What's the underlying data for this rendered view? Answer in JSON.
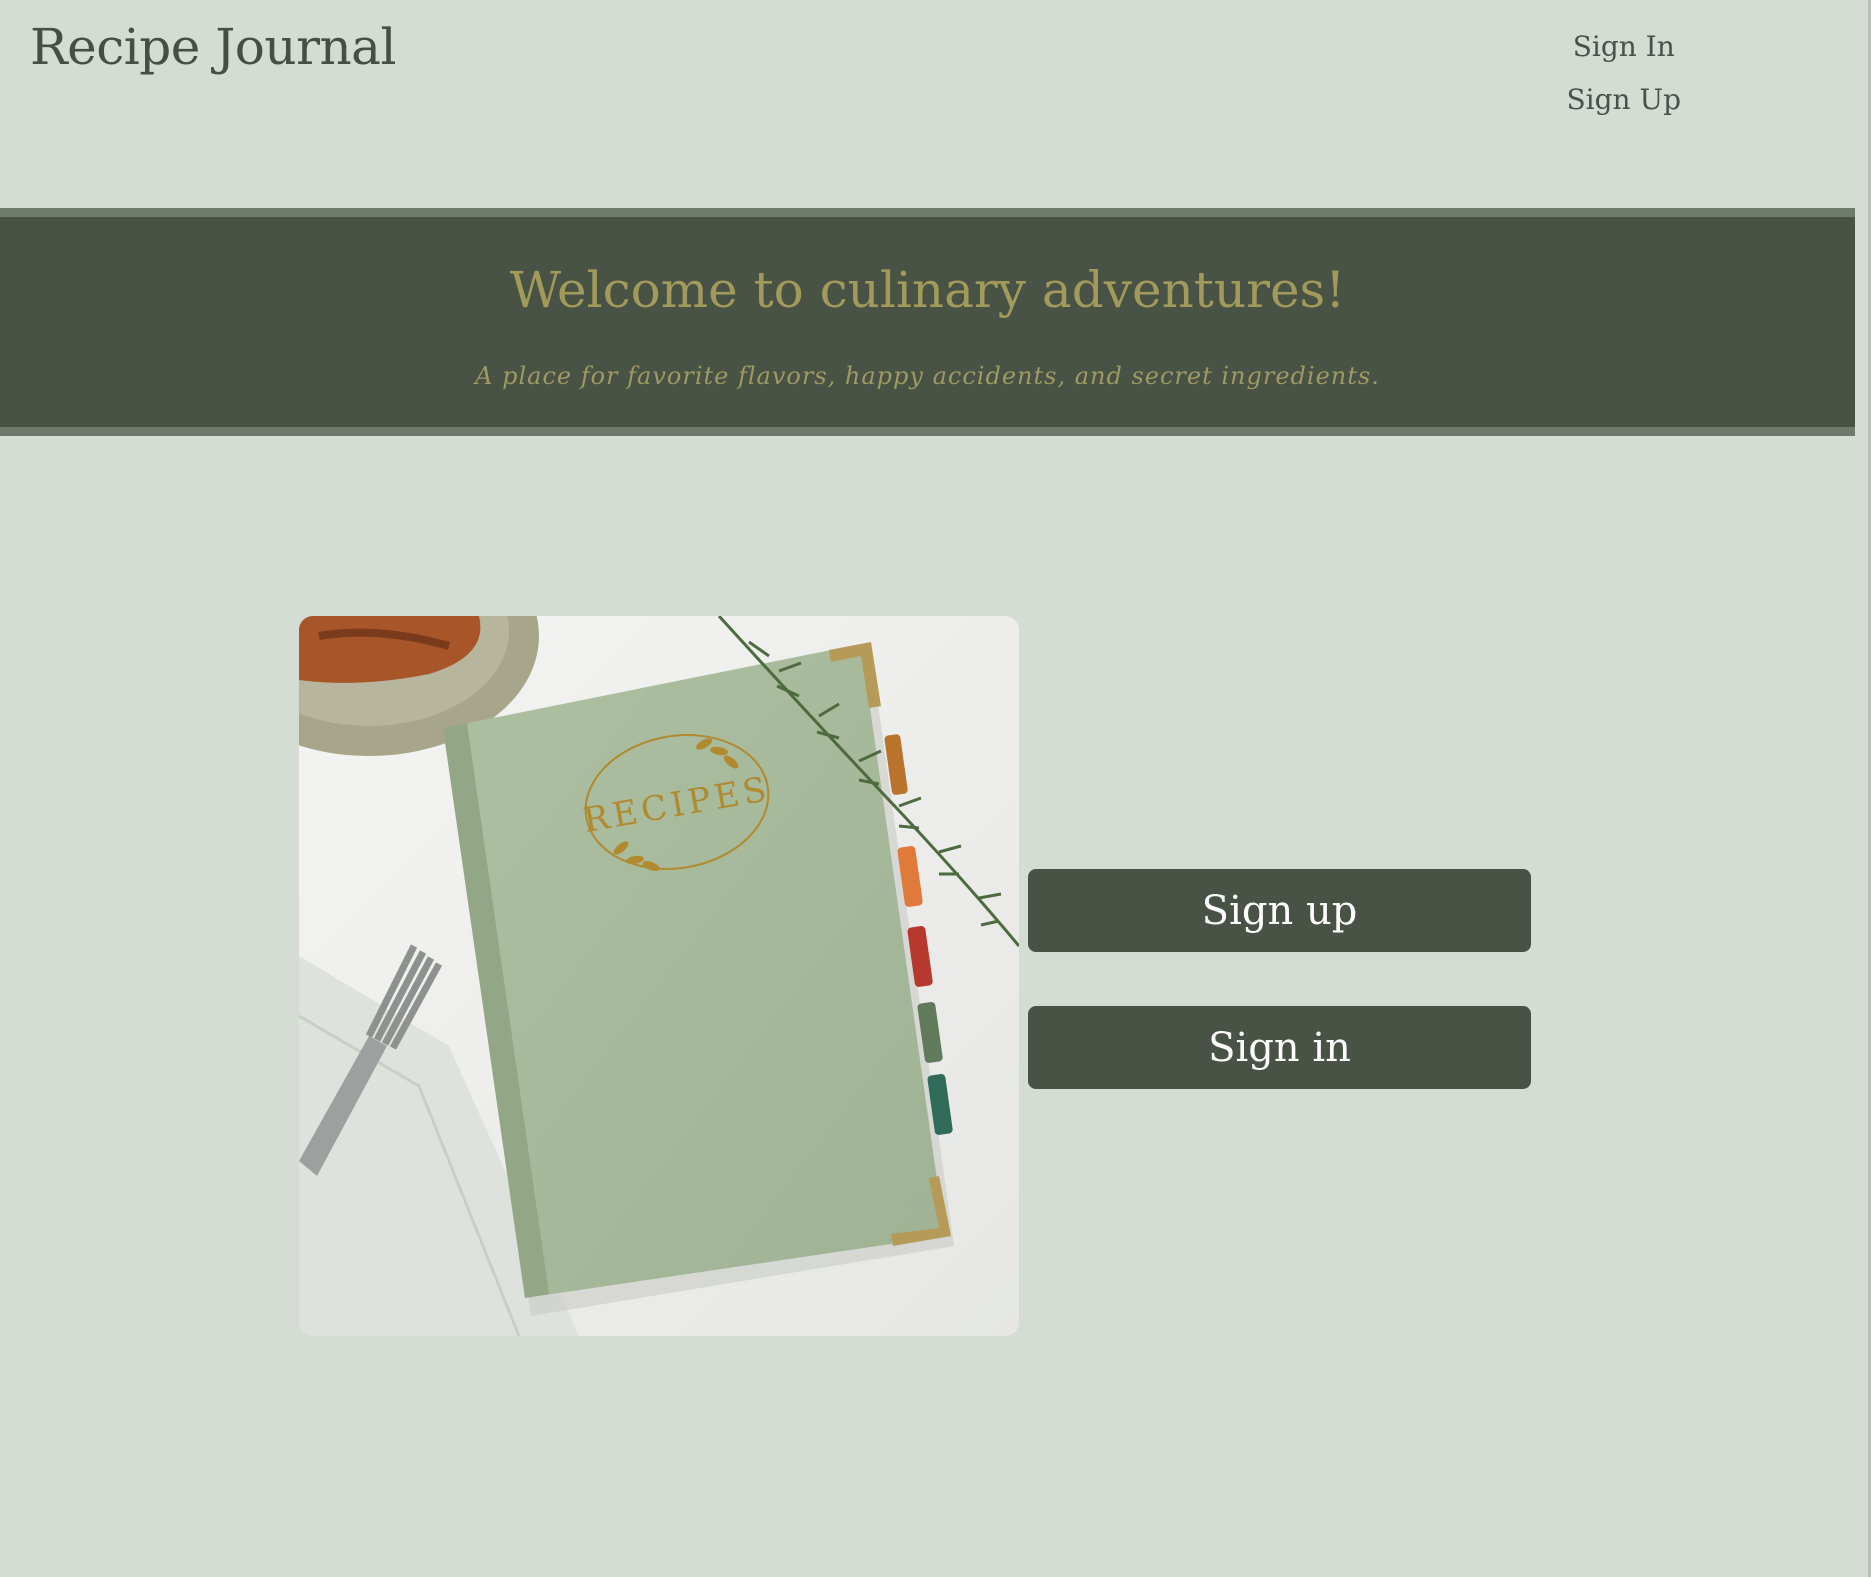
{
  "header": {
    "brand": "Recipe Journal",
    "nav": {
      "sign_in": "Sign In",
      "sign_up": "Sign Up"
    }
  },
  "banner": {
    "title": "Welcome to culinary adventures!",
    "tagline": "A place for favorite flavors, happy accidents, and secret ingredients."
  },
  "hero": {
    "book_label": "RECIPES"
  },
  "actions": {
    "sign_up": "Sign up",
    "sign_in": "Sign in"
  },
  "colors": {
    "page_bg": "#d4dcd3",
    "banner_bg": "#485245",
    "banner_text": "#a29a5a",
    "button_bg": "#485245",
    "button_text": "#ffffff"
  }
}
